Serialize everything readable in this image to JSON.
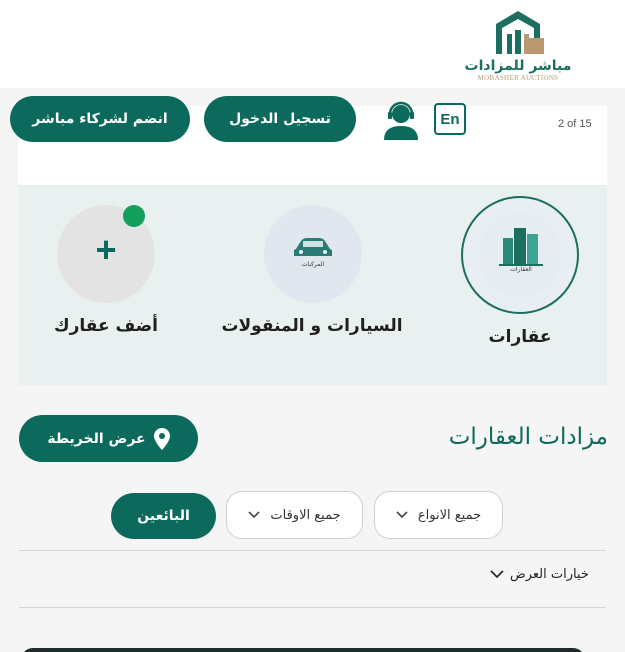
{
  "brand": {
    "name": "مباشر للمزادات",
    "subtitle": "MOBASHER AUCTIONS"
  },
  "header": {
    "partner_button": "انضم لشركاء مباشر",
    "login_button": "تسجيل الدخول",
    "language_button": "En",
    "pager": "2 of 15"
  },
  "categories": [
    {
      "label": "عقارات",
      "icon": "buildings-icon",
      "mini_label": "العقارات",
      "selected": true
    },
    {
      "label": "السيارات و المنقولات",
      "icon": "car-icon",
      "mini_label": "المركبات"
    },
    {
      "label": "أضف عقارك",
      "icon": "plus-icon",
      "symbol": "+"
    }
  ],
  "section": {
    "title": "مزادات العقارات",
    "map_button": "عرض الخريطة"
  },
  "filters": {
    "type": "جميع الانواع",
    "time": "جميع الاوقات",
    "sellers": "البائعين"
  },
  "view_options": "خيارات العرض",
  "colors": {
    "primary": "#0b6a5c",
    "accent_gold": "#b99872",
    "panel": "#e8f1f0",
    "badge_green": "#12a05b"
  }
}
